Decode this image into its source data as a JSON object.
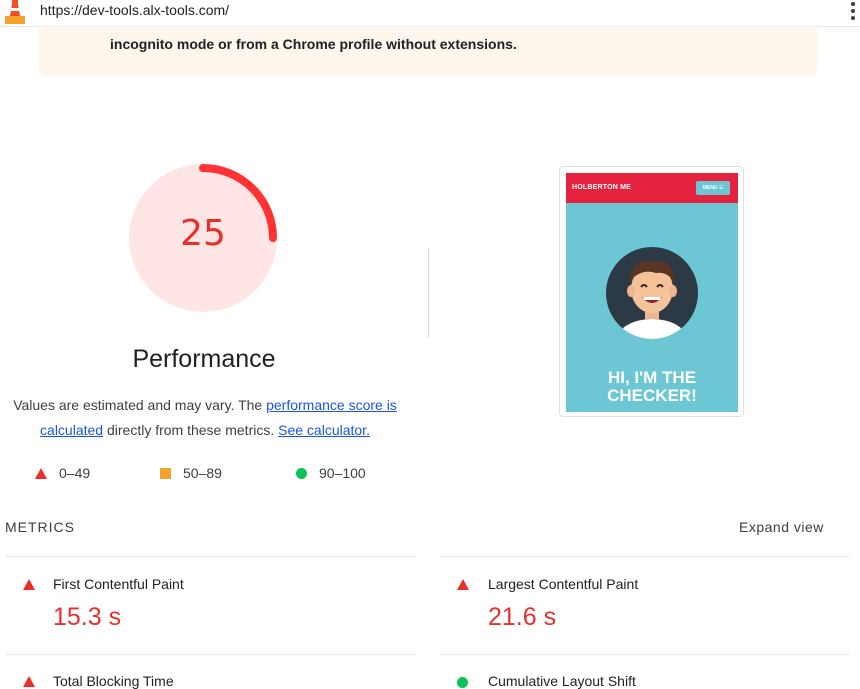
{
  "browser": {
    "url": "https://dev-tools.alx-tools.com/"
  },
  "warning": {
    "text": "incognito mode or from a Chrome profile without extensions."
  },
  "gauge": {
    "score": "25",
    "score_fraction": 0.25,
    "title": "Performance",
    "color": "#e8302a"
  },
  "note": {
    "prefix": "Values are estimated and may vary. The ",
    "link1": "performance score is calculated",
    "middle": " directly from these metrics. ",
    "link2": "See calculator."
  },
  "legend": [
    {
      "icon": "fail-triangle-icon",
      "label": "0–49",
      "color": "#e8302a"
    },
    {
      "icon": "average-square-icon",
      "label": "50–89",
      "color": "#f4a229"
    },
    {
      "icon": "pass-circle-icon",
      "label": "90–100",
      "color": "#0bc356"
    }
  ],
  "screenshot": {
    "brand": "HOLBERTON ME",
    "menu": "MENU ☰",
    "headline_line1": "HI, I'M THE",
    "headline_line2": "CHECKER!"
  },
  "metrics": {
    "title": "METRICS",
    "expand_label": "Expand view",
    "items": [
      {
        "label": "First Contentful Paint",
        "value": "15.3 s",
        "status": "fail"
      },
      {
        "label": "Largest Contentful Paint",
        "value": "21.6 s",
        "status": "fail"
      },
      {
        "label": "Total Blocking Time",
        "status": "fail"
      },
      {
        "label": "Cumulative Layout Shift",
        "status": "pass"
      }
    ]
  }
}
